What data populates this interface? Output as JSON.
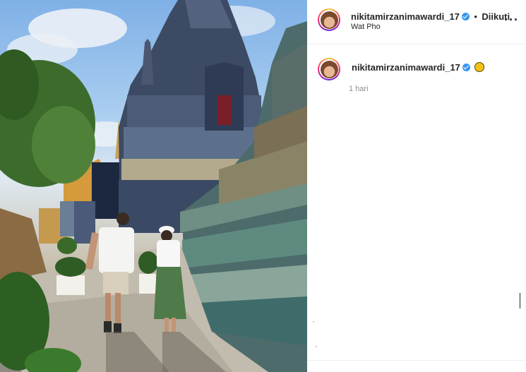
{
  "post": {
    "image_alt": "Couple walking hand in hand beside a tiled chedi at Wat Pho"
  },
  "header": {
    "username": "nikitamirzanimawardi_17",
    "separator": "•",
    "follow_label": "Diikuti",
    "location": "Wat Pho",
    "more_label": "···"
  },
  "comment": {
    "username": "nikitamirzanimawardi_17",
    "time": "1 hari"
  },
  "icons": {
    "verified": "verified-badge-icon",
    "sun": "sun-emoji-icon",
    "more": "more-options-icon"
  },
  "colors": {
    "verified": "#3897f0",
    "text": "#262626",
    "muted": "#8e8e8e"
  }
}
